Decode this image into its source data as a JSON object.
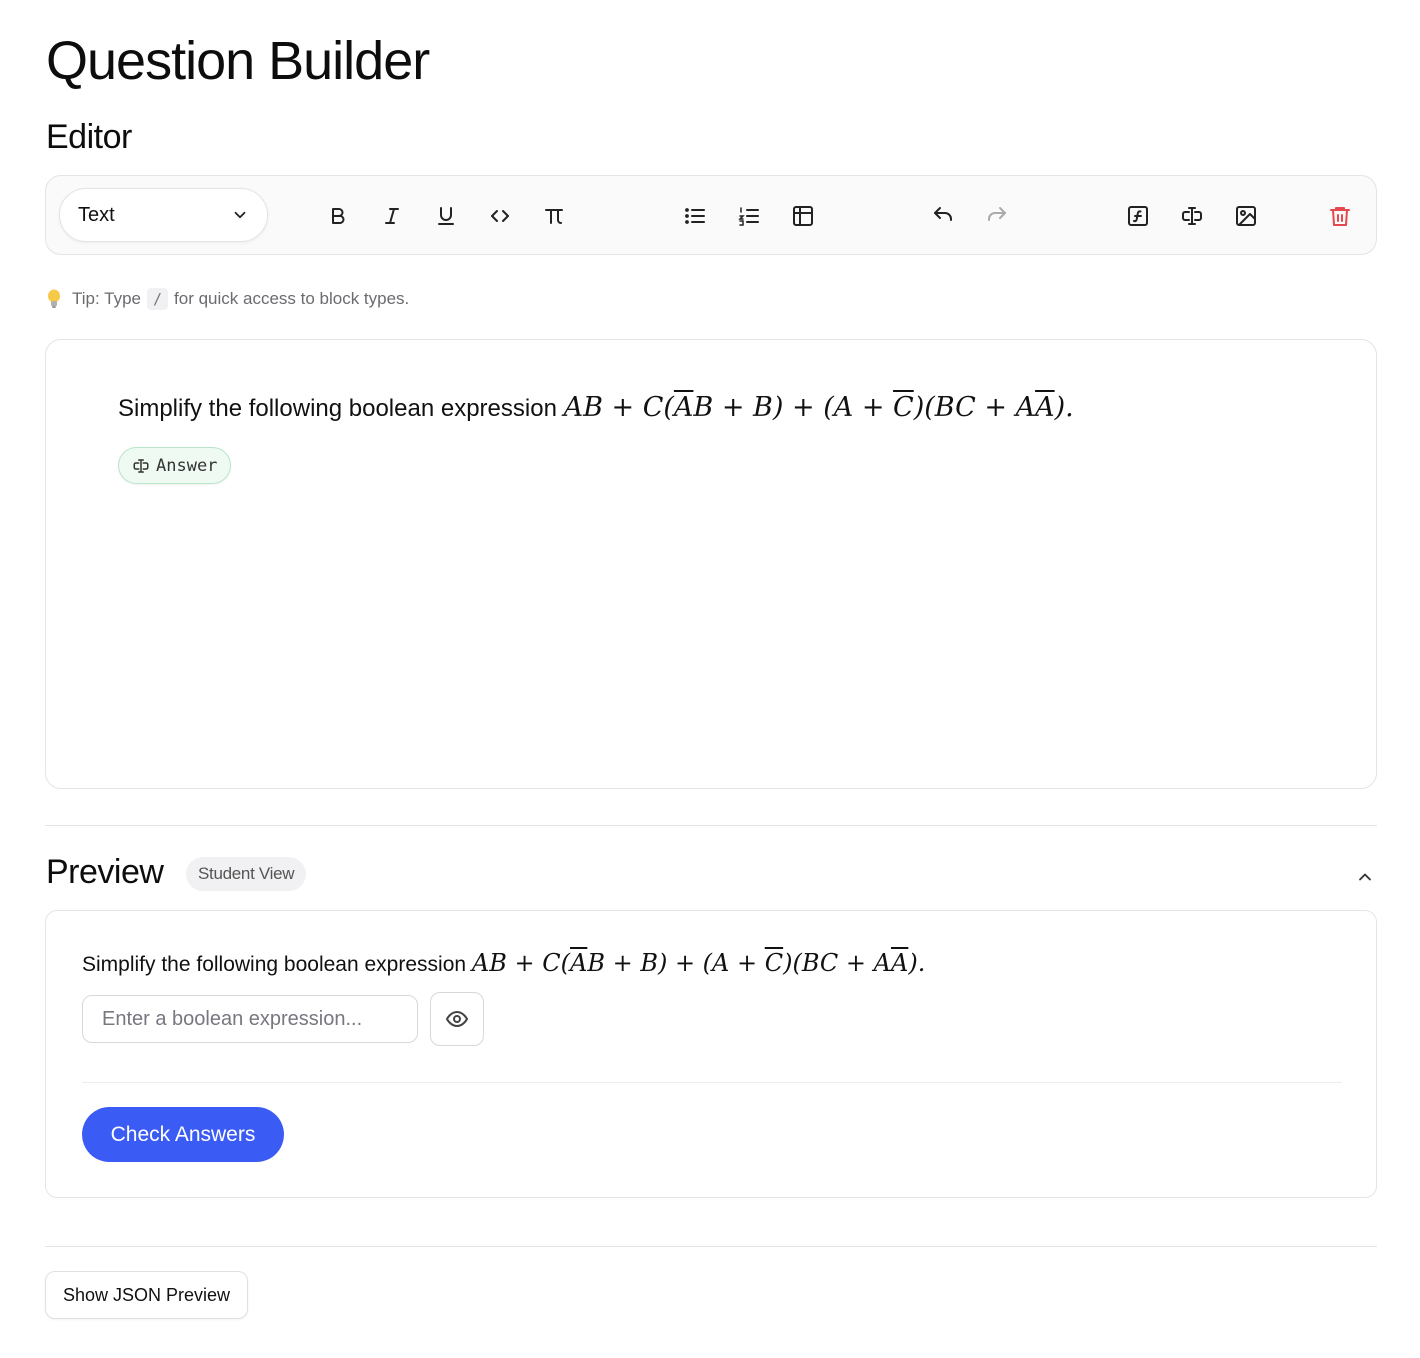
{
  "page": {
    "title": "Question Builder"
  },
  "editor": {
    "heading": "Editor",
    "block_type": "Text",
    "toolbar_icons": [
      "bold-icon",
      "italic-icon",
      "underline-icon",
      "code-icon",
      "pi-icon",
      "bullet-list-icon",
      "ordered-list-icon",
      "table-icon",
      "undo-icon",
      "redo-icon",
      "formula-icon",
      "answer-input-icon",
      "image-icon",
      "trash-icon"
    ],
    "tip_prefix": "Tip: Type",
    "tip_key": "/",
    "tip_suffix": "for quick access to block types.",
    "question_text": "Simplify the following boolean expression",
    "expr": {
      "a": "AB + C(",
      "b": "A",
      "c": "B + B) + (A + ",
      "d": "C",
      "e": ")(BC + A",
      "f": "A",
      "g": ")."
    },
    "answer_chip_label": "Answer"
  },
  "preview": {
    "heading": "Preview",
    "badge": "Student View",
    "question_text": "Simplify the following boolean expression",
    "answer_placeholder": "Enter a boolean expression...",
    "check_button": "Check Answers"
  },
  "footer": {
    "json_button": "Show JSON Preview"
  },
  "colors": {
    "accent": "#3b5bf5",
    "danger": "#e5484d",
    "chip_bg": "#eefaf2"
  }
}
